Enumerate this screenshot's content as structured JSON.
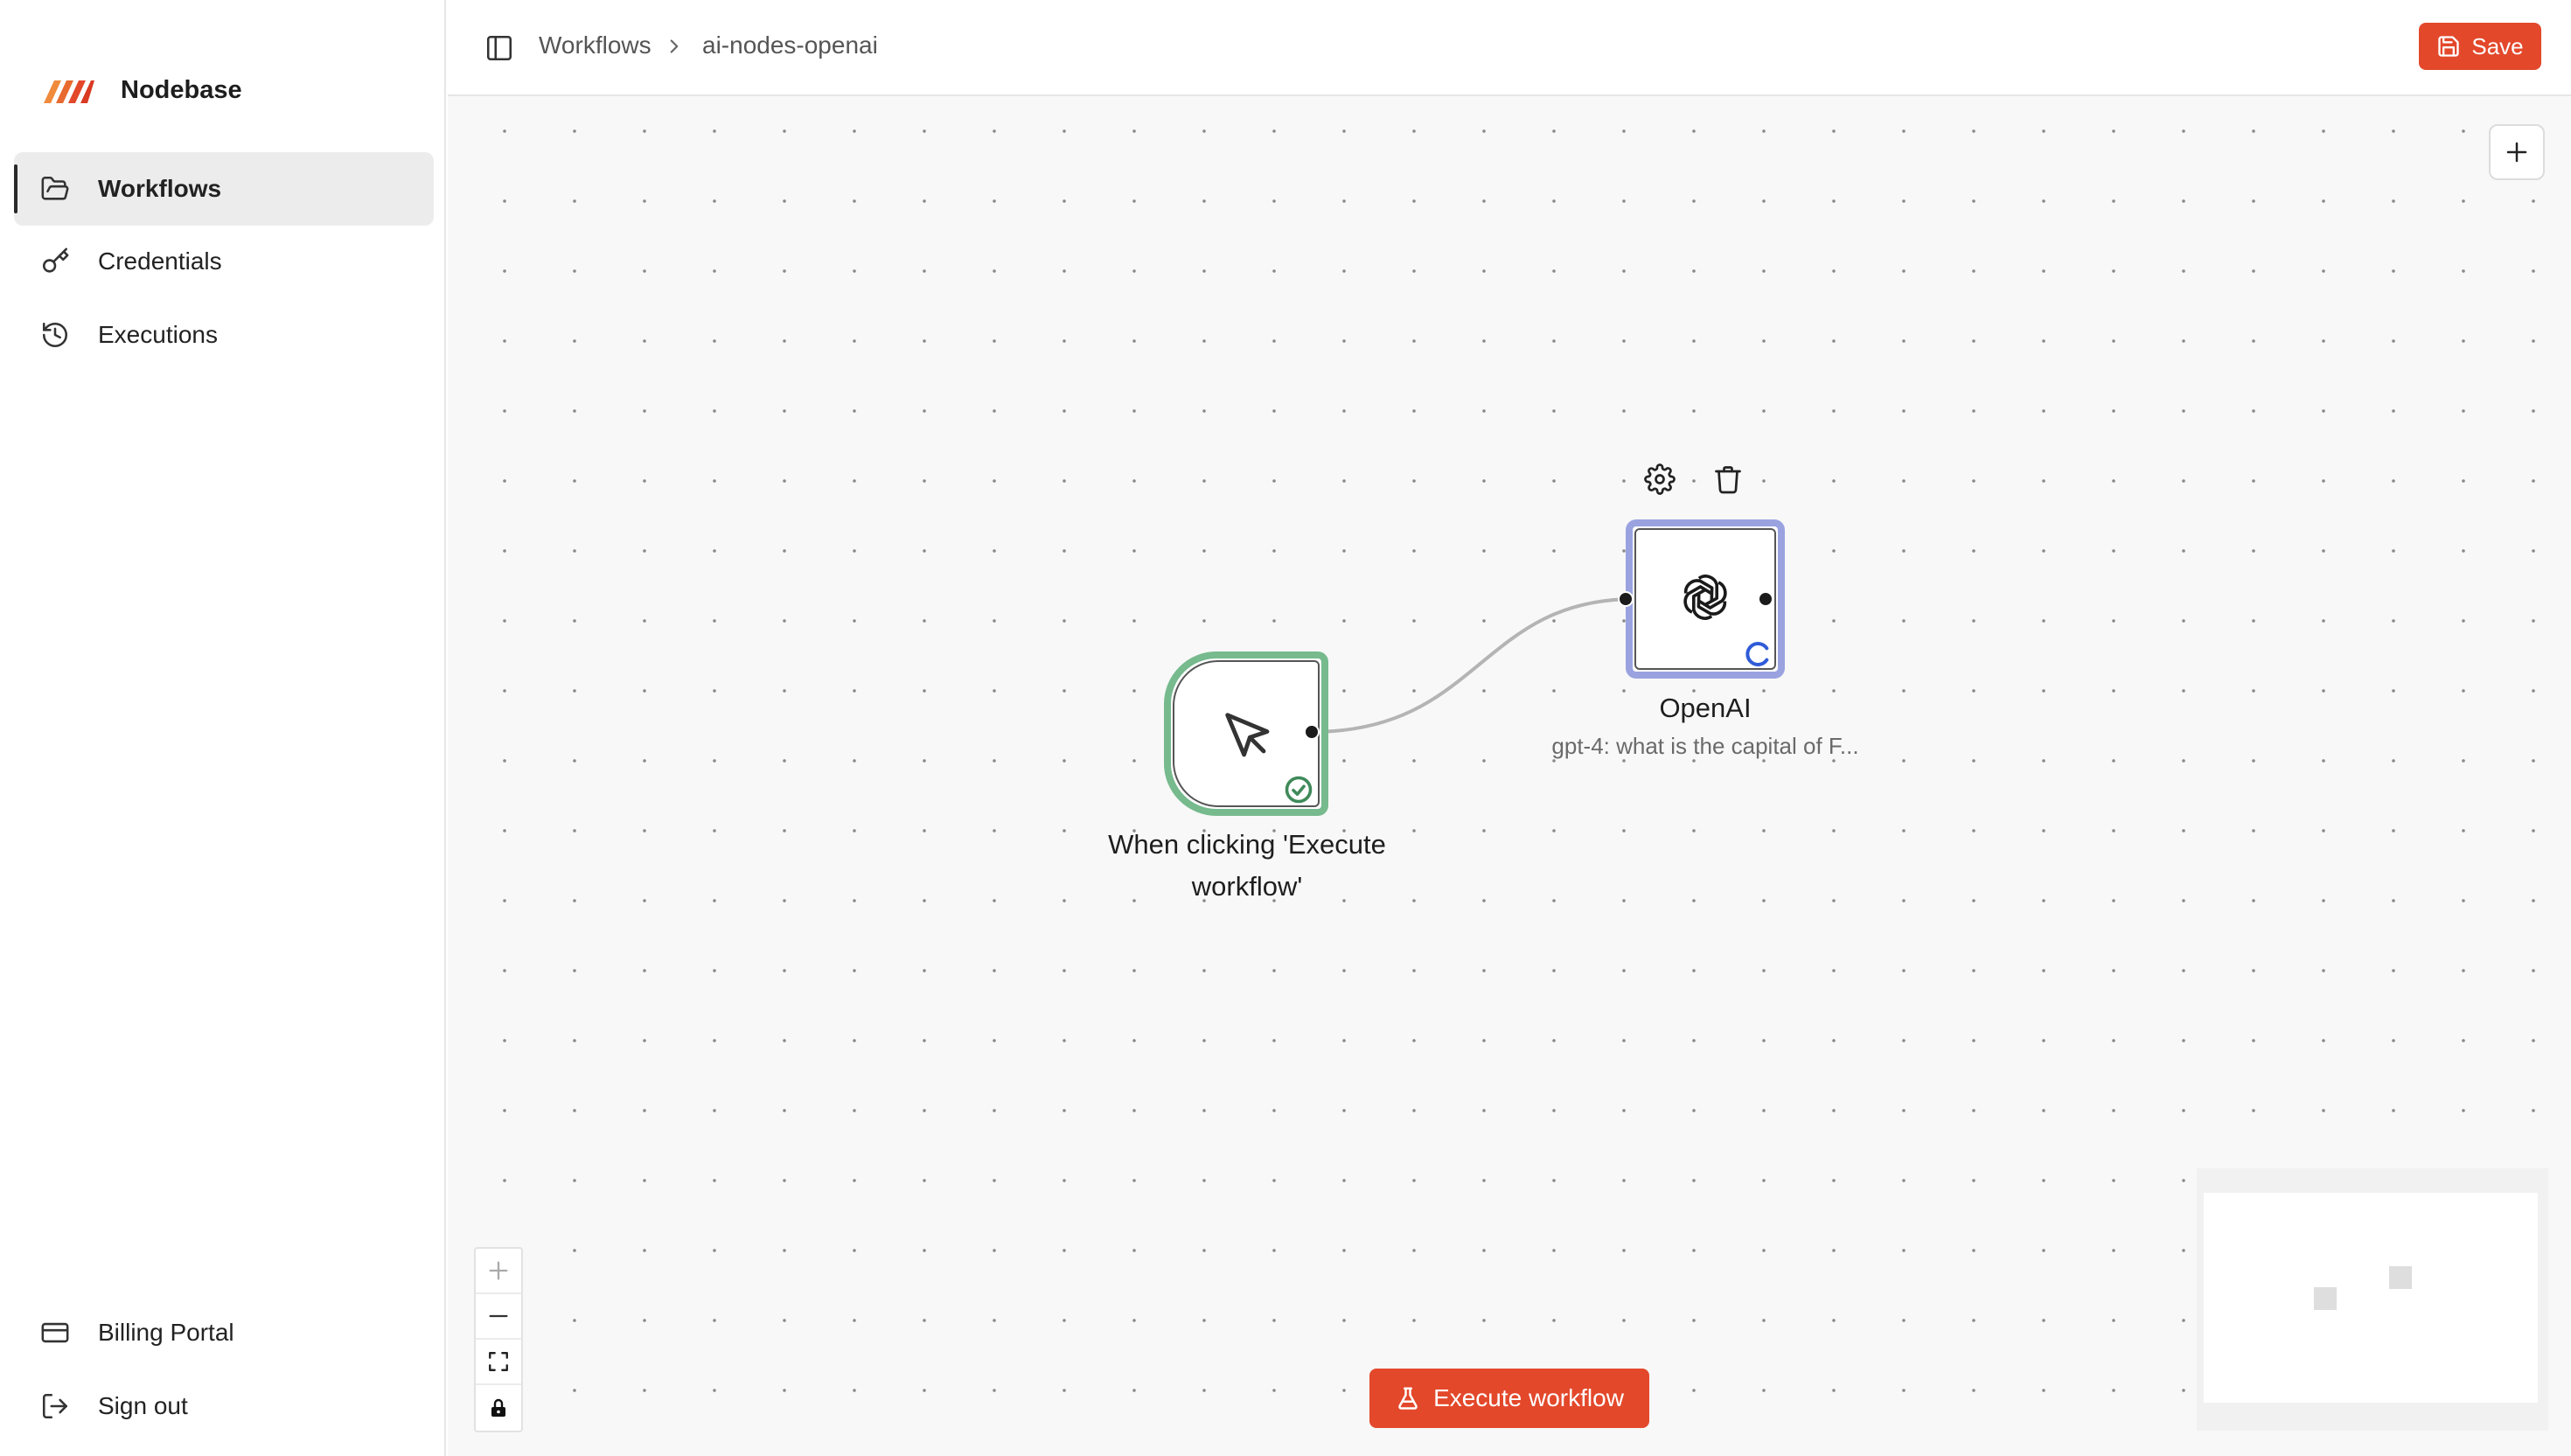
{
  "app": {
    "name": "Nodebase",
    "logo": "nodebase-logo"
  },
  "sidebar": {
    "items": [
      {
        "label": "Workflows",
        "icon": "folder-open-icon",
        "active": true
      },
      {
        "label": "Credentials",
        "icon": "key-icon",
        "active": false
      },
      {
        "label": "Executions",
        "icon": "history-icon",
        "active": false
      }
    ],
    "bottom_items": [
      {
        "label": "Billing Portal",
        "icon": "credit-card-icon"
      },
      {
        "label": "Sign out",
        "icon": "log-out-icon"
      }
    ]
  },
  "header": {
    "breadcrumb": [
      "Workflows",
      "ai-nodes-openai"
    ],
    "save_label": "Save"
  },
  "canvas": {
    "nodes": [
      {
        "type": "manual-trigger",
        "title": "When clicking 'Execute workflow'",
        "icon": "cursor-click-icon",
        "status": "success"
      },
      {
        "type": "openai",
        "title": "OpenAI",
        "subtitle": "gpt-4: what is the capital of F...",
        "icon": "openai-icon",
        "status": "loading"
      }
    ],
    "execute_label": "Execute workflow"
  },
  "colors": {
    "accent": "#e3482b",
    "trigger_border": "#76ba8d",
    "openai_border": "#9aa3e0",
    "loading": "#2f5bd8",
    "success": "#3f8a5a"
  }
}
